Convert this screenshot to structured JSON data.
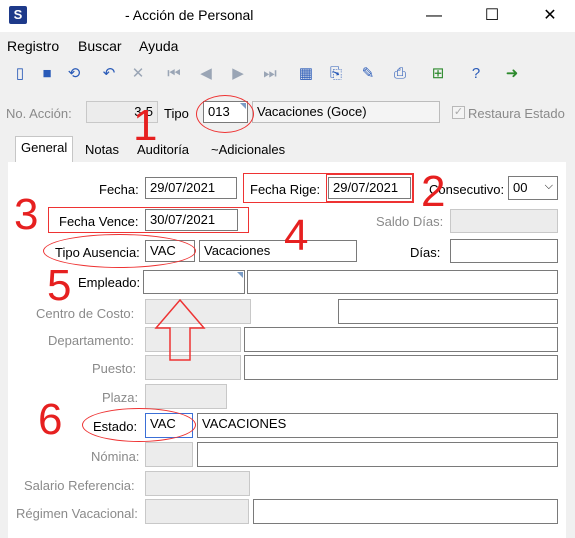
{
  "window": {
    "app_icon": "S",
    "title": "- Acción de Personal",
    "minimize": "—",
    "maximize": "☐",
    "close": "✕"
  },
  "menu": [
    "Registro",
    "Buscar",
    "Ayuda"
  ],
  "toolbar": {
    "icons": [
      "new-icon",
      "save-icon",
      "refresh-icon",
      "undo-icon",
      "delete-icon",
      "first-icon",
      "prev-icon",
      "next-icon",
      "last-icon",
      "grid-icon",
      "export-icon",
      "edit-icon",
      "print-icon",
      "calc-icon",
      "help-icon",
      "exit-icon"
    ]
  },
  "header": {
    "no_accion_label": "No. Acción:",
    "no_accion_value": "3-5",
    "tipo_label": "Tipo",
    "tipo_code": "013",
    "tipo_desc": "Vacaciones (Goce)",
    "restaura_label": "Restaura Estado",
    "restaura_checked": "✓"
  },
  "tabs": [
    "General",
    "Notas",
    "Auditoría",
    "~Adicionales"
  ],
  "form": {
    "fecha_label": "Fecha:",
    "fecha_value": "29/07/2021",
    "fecha_rige_label": "Fecha Rige:",
    "fecha_rige_value": "29/07/2021",
    "consecutivo_label": "Consecutivo:",
    "consecutivo_value": "00",
    "fecha_vence_label": "Fecha Vence:",
    "fecha_vence_value": "30/07/2021",
    "saldo_dias_label": "Saldo Días:",
    "tipo_ausencia_label": "Tipo Ausencia:",
    "tipo_ausencia_code": "VAC",
    "tipo_ausencia_desc": "Vacaciones",
    "dias_label": "Días:",
    "empleado_label": "Empleado:",
    "centro_costo_label": "Centro de Costo:",
    "departamento_label": "Departamento:",
    "puesto_label": "Puesto:",
    "plaza_label": "Plaza:",
    "estado_label": "Estado:",
    "estado_code": "VAC",
    "estado_desc": "VACACIONES",
    "nomina_label": "Nómina:",
    "salario_label": "Salario Referencia:",
    "regimen_label": "Régimen Vacacional:"
  },
  "annotations": {
    "n1": "1",
    "n2": "2",
    "n3": "3",
    "n4": "4",
    "n5": "5",
    "n6": "6"
  },
  "colors": {
    "annotation": "#e33333",
    "corner": "#7a9cc6"
  }
}
